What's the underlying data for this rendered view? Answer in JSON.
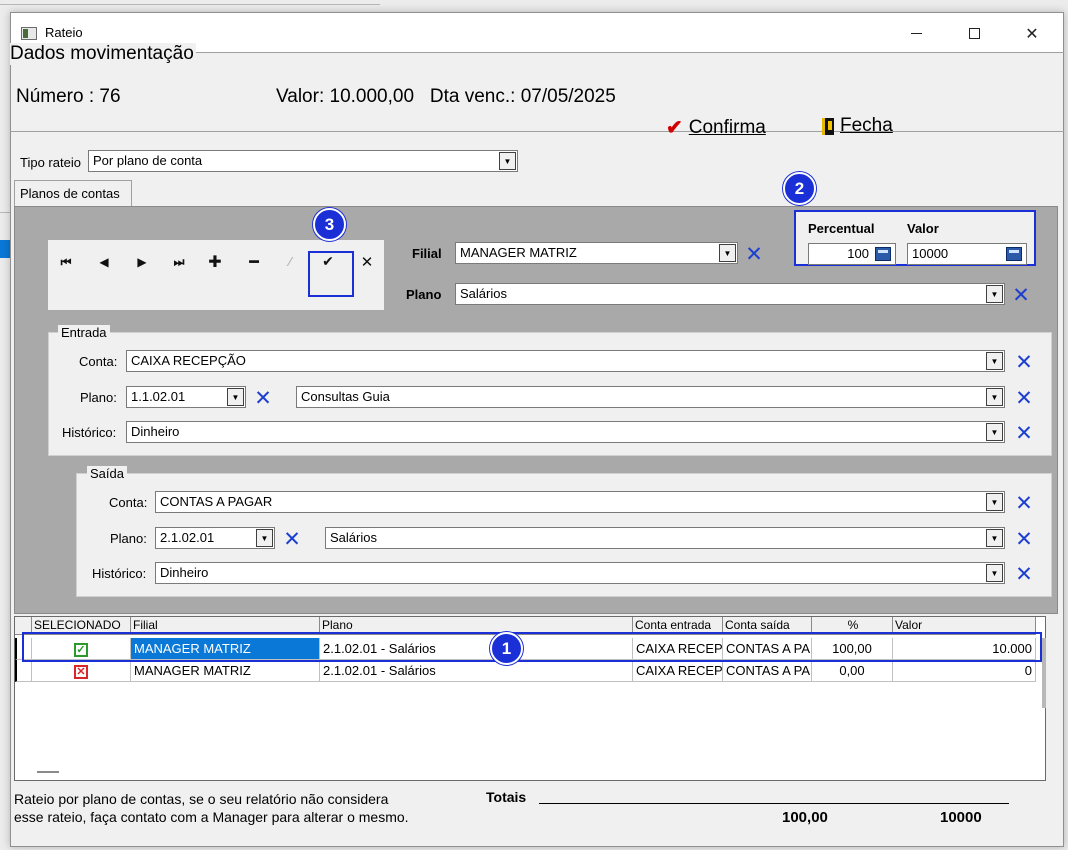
{
  "window": {
    "title": "Rateio"
  },
  "header": {
    "group_title": "Dados movimentação",
    "numero_label": "Número :",
    "numero_value": "76",
    "valor_label": "Valor:",
    "valor_value": "10.000,00",
    "venc_label": "Dta venc.:",
    "venc_value": "07/05/2025",
    "confirm_label": "Confirma",
    "close_label": "Fecha"
  },
  "tipo_rateio": {
    "label": "Tipo rateio",
    "value": "Por plano de conta"
  },
  "tabs": [
    {
      "label": "Planos de contas"
    }
  ],
  "filial": {
    "label": "Filial",
    "value": "MANAGER MATRIZ"
  },
  "plano": {
    "label": "Plano",
    "value": "Salários"
  },
  "percentual": {
    "label": "Percentual",
    "value": "100"
  },
  "valor": {
    "label": "Valor",
    "value": "10000"
  },
  "entrada": {
    "title": "Entrada",
    "conta_label": "Conta:",
    "conta_value": "CAIXA RECEPÇÃO",
    "plano_label": "Plano:",
    "plano_code": "1.1.02.01",
    "plano_desc": "Consultas Guia",
    "historico_label": "Histórico:",
    "historico_value": "Dinheiro"
  },
  "saida": {
    "title": "Saída",
    "conta_label": "Conta:",
    "conta_value": "CONTAS A PAGAR",
    "plano_label": "Plano:",
    "plano_code": "2.1.02.01",
    "plano_desc": "Salários",
    "historico_label": "Histórico:",
    "historico_value": "Dinheiro"
  },
  "grid": {
    "columns": [
      "SELECIONADO",
      "Filial",
      "Plano",
      "Conta entrada",
      "Conta saída",
      "%",
      "Valor"
    ],
    "rows": [
      {
        "selecionado": true,
        "filial": "MANAGER MATRIZ",
        "plano": "2.1.02.01 - Salários",
        "conta_entrada": "CAIXA RECEP",
        "conta_saida": "CONTAS A PA",
        "pct": "100,00",
        "valor": "10.000"
      },
      {
        "selecionado": false,
        "filial": "MANAGER MATRIZ",
        "plano": "2.1.02.01 - Salários",
        "conta_entrada": "CAIXA RECEP",
        "conta_saida": "CONTAS A PA",
        "pct": "0,00",
        "valor": "0"
      }
    ]
  },
  "footer": {
    "note_line1": "Rateio por plano de contas, se o seu relatório não considera",
    "note_line2": "esse rateio, faça contato com a Manager para alterar o mesmo.",
    "totals_label": "Totais",
    "total_pct": "100,00",
    "total_valor": "10000"
  },
  "callouts": [
    "1",
    "2",
    "3"
  ],
  "colors": {
    "accent": "#1b2fd6",
    "selection": "#0a78d7",
    "check_on": "#2b9a2b",
    "check_off": "#d9262b"
  },
  "icons": {
    "nav": [
      "first-icon",
      "prev-icon",
      "next-icon",
      "last-icon",
      "add-icon",
      "remove-icon",
      "edit-icon",
      "post-icon",
      "cancel-icon"
    ]
  }
}
